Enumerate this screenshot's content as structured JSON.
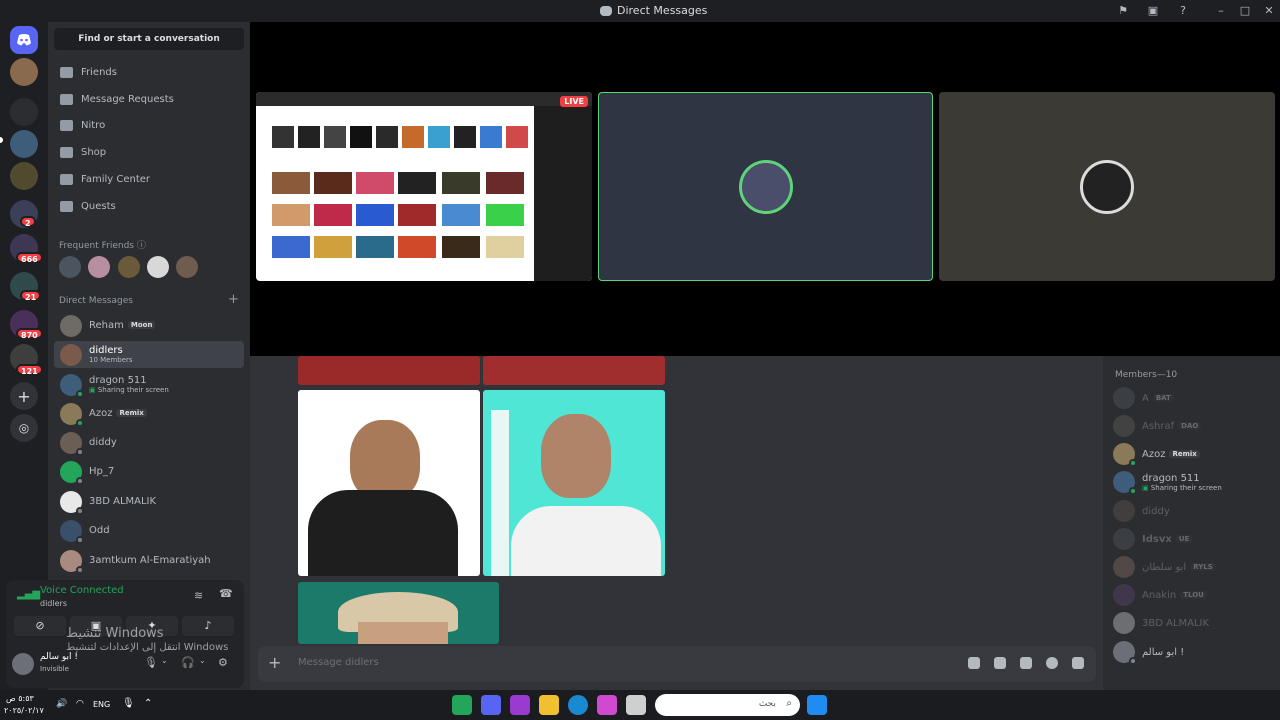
{
  "window": {
    "title": "Direct Messages"
  },
  "sidebar": {
    "search_placeholder": "Find or start a conversation",
    "nav": [
      {
        "label": "Friends",
        "icon": "friends-icon"
      },
      {
        "label": "Message Requests",
        "icon": "mail-icon"
      },
      {
        "label": "Nitro",
        "icon": "nitro-icon"
      },
      {
        "label": "Shop",
        "icon": "shop-icon"
      },
      {
        "label": "Family Center",
        "icon": "family-icon"
      },
      {
        "label": "Quests",
        "icon": "quests-icon"
      }
    ],
    "frequent_friends_label": "Frequent Friends",
    "direct_messages_label": "Direct Messages",
    "dms": [
      {
        "name": "Reham",
        "tag": "Moon"
      },
      {
        "name": "didlers",
        "sub": "10 Members",
        "active": true
      },
      {
        "name": "dragon 511",
        "sub": "Sharing their screen"
      },
      {
        "name": "Azoz",
        "tag": "Remix"
      },
      {
        "name": "diddy"
      },
      {
        "name": "Hp_7"
      },
      {
        "name": "3BD ALMALIK"
      },
      {
        "name": "Odd"
      },
      {
        "name": "3amtkum Al-Emaratiyah"
      }
    ]
  },
  "servers": {
    "badges": [
      "2",
      "666",
      "21",
      "870",
      "121"
    ]
  },
  "voice": {
    "status": "Voice Connected",
    "channel": "didlers",
    "user_name": "ابو سالم !",
    "user_status": "Invisible"
  },
  "stage": {
    "live_label": "LIVE"
  },
  "composer": {
    "placeholder": "Message didlers"
  },
  "members": {
    "header": "Members—10",
    "list": [
      {
        "name": "A",
        "tag": "BAT",
        "dim": true
      },
      {
        "name": "Ashraf",
        "tag": "DAO",
        "dim": true
      },
      {
        "name": "Azoz",
        "tag": "Remix"
      },
      {
        "name": "dragon 511",
        "sub": "Sharing their screen"
      },
      {
        "name": "diddy",
        "dim": true
      },
      {
        "name": "Idsvx",
        "tag": "UE",
        "dim": true
      },
      {
        "name": "ابو سلطان",
        "tag": "RYLS",
        "dim": true
      },
      {
        "name": "Anakin",
        "tag": "TLOU",
        "dim": true
      },
      {
        "name": "3BD ALMALIK",
        "dim": true
      },
      {
        "name": "ابو سالم !"
      }
    ]
  },
  "watermark": {
    "line1": "تنشيط Windows",
    "line2": "انتقل إلى الإعدادات لتنشيط Windows"
  },
  "taskbar": {
    "lang": "ENG",
    "search_placeholder": "بحث",
    "clock_time": "٥:٥٣ ص",
    "clock_date": "٢٠٢٥/٠٢/١٧"
  },
  "colors": {
    "accent": "#5865f2",
    "online": "#23a55a",
    "danger": "#f23f43"
  }
}
